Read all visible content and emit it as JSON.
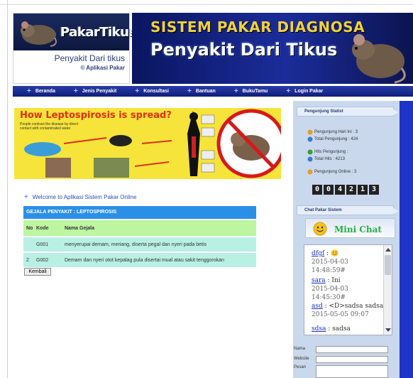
{
  "header": {
    "logo_title": "PakarTikus",
    "logo_subtitle": "Penyakit Dari tikus",
    "logo_copyright": "© Aplikasi Pakar",
    "banner_line1": "SISTEM PAKAR DIAGNOSA",
    "banner_line2": "Penyakit Dari Tikus"
  },
  "nav": {
    "items": [
      {
        "label": "Beranda"
      },
      {
        "label": "Jenis Penyakit"
      },
      {
        "label": "Konsultasi"
      },
      {
        "label": "Bantuan"
      },
      {
        "label": "BukuTamu"
      },
      {
        "label": "Login Pakar"
      }
    ]
  },
  "main": {
    "lepto_title": "How Leptospirosis is spread?",
    "lepto_sub": "People contract the disease by direct contact with contaminated water",
    "welcome": "Welcome to Aplikasi Sistem Pakar Online",
    "table_title": "GEJALA PENYAKIT : LEPTOSPIROSIS",
    "col_no": "No",
    "col_kode": "Kode",
    "col_gejala": "Nama Gejala",
    "rows": [
      {
        "no": "",
        "kode": "G001",
        "gejala": "menyerupai demam, meriang, diserta pegal dan nyeri pada betis"
      },
      {
        "no": "2",
        "kode": "G002",
        "gejala": "Demam dan nyeri otot kepalag pula disertai mual atau sakit tenggorokan"
      }
    ],
    "back_button": "Kembali"
  },
  "sidebar": {
    "pengunjung_title": "Pengunjung Statist",
    "stats": [
      {
        "label": "Pengunjung Hari Ini : 3"
      },
      {
        "label": "Total Pengunjung : 424"
      },
      {
        "label": "Hits Pengunjung :"
      },
      {
        "label": "Total Hits : 4213"
      },
      {
        "label": "Pengunjung Online : 3"
      }
    ],
    "counter_digits": [
      "0",
      "0",
      "4",
      "2",
      "1",
      "3"
    ],
    "chat_section_title": "Chat Pakar Sistem",
    "mini_chat_label": "Mini Chat",
    "chat_messages": [
      {
        "who": "dfgf",
        "text": " : 😊",
        "time": "2015-04-03 14:48:59#"
      },
      {
        "who": "sara",
        "text": " : Ini",
        "time": "2015-04-03 14:45:30#"
      },
      {
        "who": "asd",
        "text": " : <D>sadsa sadsa",
        "time": "2015-05-05 09:07"
      },
      {
        "who": "sdsa",
        "text": " : sadsa",
        "time": ""
      }
    ],
    "form_nama": "Nama",
    "form_website": "Website",
    "form_pesan": "Pesan"
  }
}
